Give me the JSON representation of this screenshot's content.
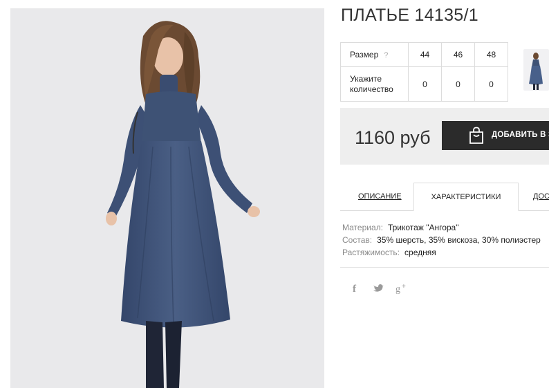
{
  "product": {
    "title": "ПЛАТЬЕ 14135/1"
  },
  "sizes_table": {
    "size_label": "Размер",
    "help_mark": "?",
    "sizes": [
      "44",
      "46",
      "48"
    ],
    "qty_label": "Укажите количество",
    "quantities": [
      "0",
      "0",
      "0"
    ]
  },
  "purchase": {
    "price": "1160 руб",
    "add_to_cart_label": "ДОБАВИТЬ В ЗА"
  },
  "tabs": [
    {
      "label": "ОПИСАНИЕ",
      "active": false
    },
    {
      "label": "ХАРАКТЕРИСТИКИ",
      "active": true
    },
    {
      "label": "ДОС",
      "active": false
    }
  ],
  "specs": [
    {
      "key": "Материал:",
      "value": "Трикотаж \"Ангора\""
    },
    {
      "key": "Состав:",
      "value": "35% шерсть, 35% вискоза, 30% полиэстер"
    },
    {
      "key": "Растяжимость:",
      "value": "средняя"
    }
  ],
  "social": [
    {
      "icon": "facebook-icon",
      "glyph": "f"
    },
    {
      "icon": "twitter-icon",
      "glyph": "t"
    },
    {
      "icon": "google-plus-icon",
      "glyph": "g+"
    }
  ],
  "colors": {
    "dress": "#3e5275",
    "button": "#2b2b2b",
    "price_bg": "#eeeeee",
    "photo_bg": "#e9e9eb"
  }
}
